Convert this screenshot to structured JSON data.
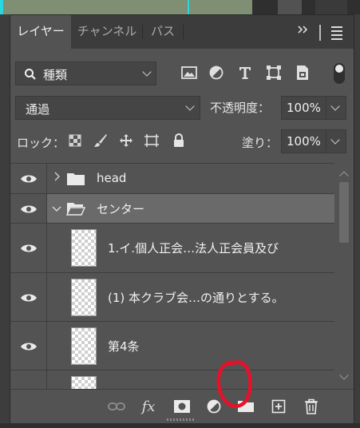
{
  "tabs": [
    {
      "label": "レイヤー",
      "active": true
    },
    {
      "label": "チャンネル",
      "active": false
    },
    {
      "label": "パス",
      "active": false
    }
  ],
  "tab_overflow": "»",
  "filter": {
    "label": "種類",
    "icons": [
      "image-filter-icon",
      "adjustment-filter-icon",
      "type-filter-icon",
      "shape-filter-icon",
      "smart-object-filter-icon"
    ]
  },
  "blend_mode": "通過",
  "opacity": {
    "label": "不透明度：",
    "value": "100%"
  },
  "lock": {
    "label": "ロック：",
    "icons": [
      "lock-transparent-icon",
      "lock-image-icon",
      "lock-position-icon",
      "lock-artboard-icon",
      "lock-all-icon"
    ]
  },
  "fill": {
    "label": "塗り：",
    "value": "100%"
  },
  "layers": [
    {
      "name": "head",
      "type": "group",
      "expanded": false,
      "visible": true,
      "selected": false
    },
    {
      "name": "センター",
      "type": "group",
      "expanded": true,
      "visible": true,
      "selected": true
    },
    {
      "name": "1.イ.個人正会…法人正会員及び",
      "type": "text",
      "visible": true,
      "selected": false
    },
    {
      "name": "(1)  本クラブ会…の通りとする。",
      "type": "text",
      "visible": true,
      "selected": false
    },
    {
      "name": "第4条",
      "type": "text",
      "visible": true,
      "selected": false
    },
    {
      "name": "",
      "type": "text",
      "visible": false,
      "selected": false
    }
  ],
  "bottom_icons": [
    "link-layers-icon",
    "layer-style-fx-icon",
    "add-mask-icon",
    "new-adjustment-layer-icon",
    "new-group-folder-icon",
    "new-layer-icon",
    "delete-layer-icon"
  ],
  "fx_label": "fx",
  "annotation_color": "#e8102a"
}
